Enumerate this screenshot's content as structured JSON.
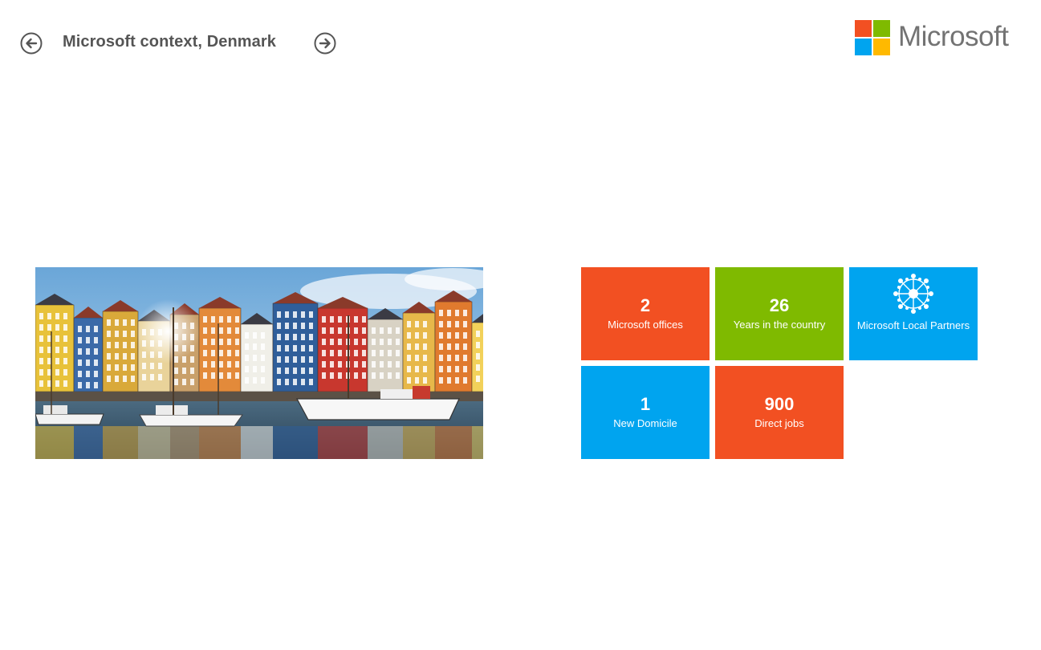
{
  "header": {
    "title": "Microsoft context, Denmark",
    "back_icon": "arrow-left-circle-icon",
    "forward_icon": "arrow-right-circle-icon"
  },
  "brand": {
    "name": "Microsoft",
    "logo_colors": [
      "#F25022",
      "#7FBA00",
      "#00A4EF",
      "#FFB900"
    ]
  },
  "hero": {
    "description_icon": "nyhavn-harbor-photo"
  },
  "tiles": [
    {
      "number": "2",
      "label": "Microsoft offices",
      "color": "#F25022"
    },
    {
      "number": "26",
      "label": "Years in the country",
      "color": "#7FBA00"
    },
    {
      "number": "",
      "label": "Microsoft Local Partners",
      "color": "#00A4EF",
      "icon": "network-hub-icon"
    },
    {
      "number": "1",
      "label": "New Domicile",
      "color": "#00A4EF"
    },
    {
      "number": "900",
      "label": "Direct jobs",
      "color": "#F25022"
    }
  ]
}
